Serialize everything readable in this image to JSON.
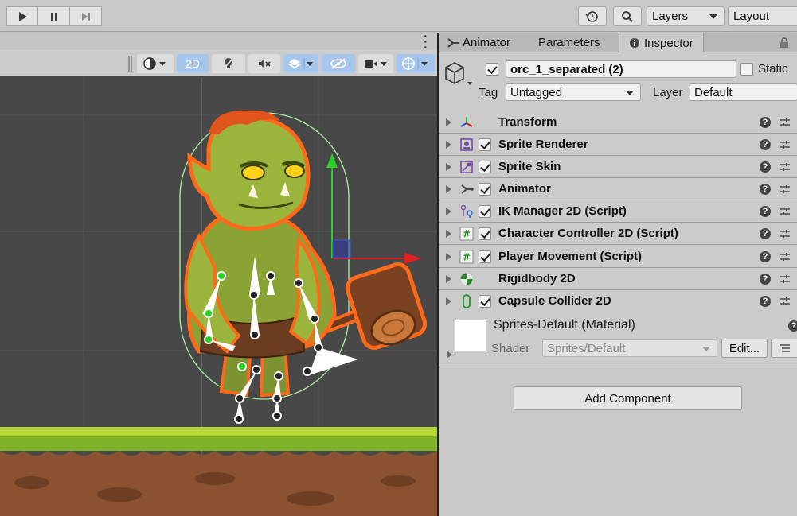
{
  "toolbar": {
    "play_icon": "play-icon",
    "pause_icon": "pause-icon",
    "step_icon": "step-icon",
    "history_icon": "history-icon",
    "search_icon": "search-icon",
    "layers_label": "Layers",
    "layout_label": "Layout"
  },
  "scene": {
    "toolbar": {
      "mode_2d_label": "2D"
    }
  },
  "inspector": {
    "tabs": [
      {
        "label": "Animator",
        "icon": "animator-icon"
      },
      {
        "label": "Parameters"
      },
      {
        "label": "Inspector",
        "icon": "info-icon"
      }
    ],
    "gameobject": {
      "active": true,
      "name": "orc_1_separated (2)",
      "static_label": "Static",
      "static": false,
      "tag_label": "Tag",
      "tag_value": "Untagged",
      "layer_label": "Layer",
      "layer_value": "Default"
    },
    "components": [
      {
        "name": "Transform",
        "icon": "transform-icon",
        "has_checkbox": false
      },
      {
        "name": "Sprite Renderer",
        "icon": "sprite-renderer-icon",
        "has_checkbox": true,
        "enabled": true
      },
      {
        "name": "Sprite Skin",
        "icon": "sprite-skin-icon",
        "has_checkbox": true,
        "enabled": true
      },
      {
        "name": "Animator",
        "icon": "animator-icon",
        "has_checkbox": true,
        "enabled": true
      },
      {
        "name": "IK Manager 2D (Script)",
        "icon": "ik-manager-icon",
        "has_checkbox": true,
        "enabled": true
      },
      {
        "name": "Character Controller 2D (Script)",
        "icon": "script-icon",
        "has_checkbox": true,
        "enabled": true
      },
      {
        "name": "Player Movement (Script)",
        "icon": "script-icon",
        "has_checkbox": true,
        "enabled": true
      },
      {
        "name": "Rigidbody 2D",
        "icon": "rigidbody-icon",
        "has_checkbox": false
      },
      {
        "name": "Capsule Collider 2D",
        "icon": "capsule-collider-icon",
        "has_checkbox": true,
        "enabled": true
      }
    ],
    "material": {
      "name": "Sprites-Default (Material)",
      "shader_label": "Shader",
      "shader_value": "Sprites/Default",
      "edit_label": "Edit..."
    },
    "add_component_label": "Add Component"
  },
  "colors": {
    "accent_blue": "#a6c6ee",
    "scene_bg": "#484848",
    "gizmo_y": "#2ad02a",
    "gizmo_x": "#e02020"
  }
}
